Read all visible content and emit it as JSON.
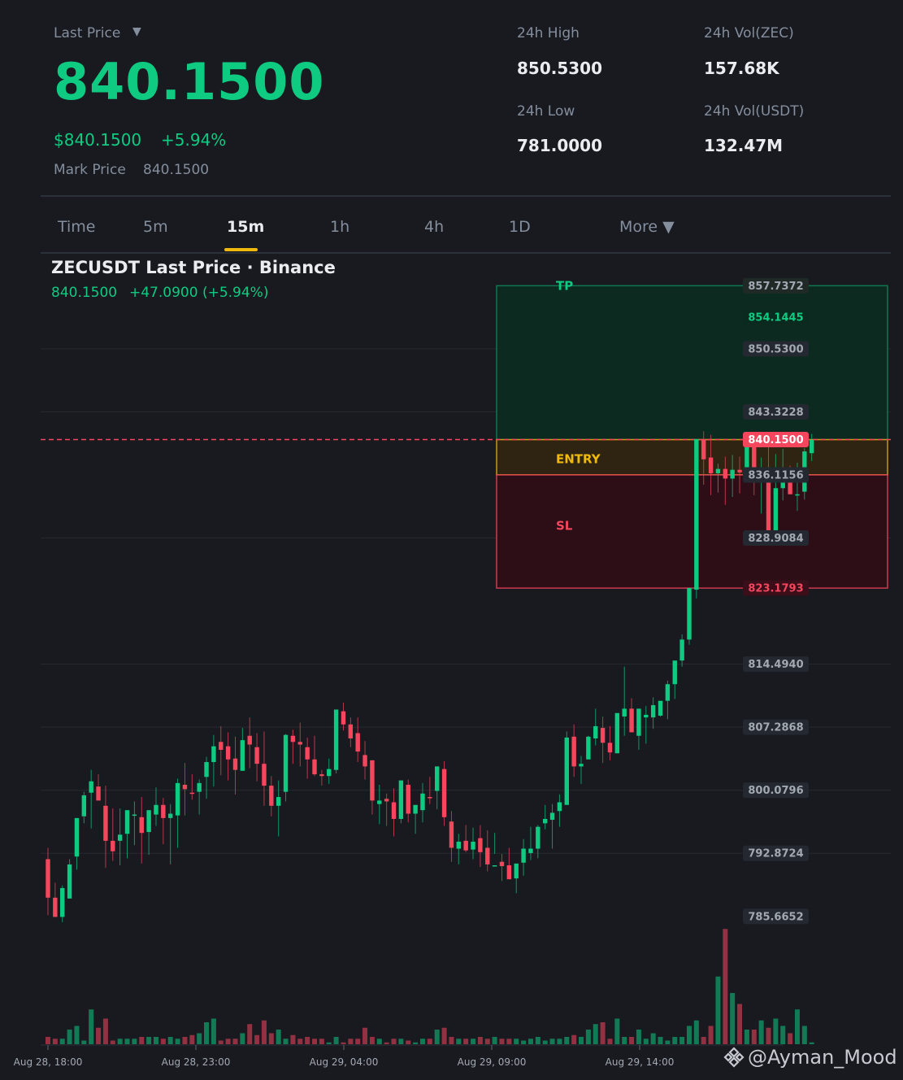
{
  "header": {
    "last_price_label": "Last Price",
    "last_price_caret": "▼",
    "last_price": "840.1500",
    "usd_price": "$840.1500",
    "change_pct": "+5.94%",
    "mark_price_label": "Mark Price",
    "mark_price": "840.1500"
  },
  "stats": {
    "high_label": "24h High",
    "high": "850.5300",
    "low_label": "24h Low",
    "low": "781.0000",
    "vol_base_label": "24h Vol(ZEC)",
    "vol_base": "157.68K",
    "vol_quote_label": "24h Vol(USDT)",
    "vol_quote": "132.47M"
  },
  "tabs": {
    "time": "Time",
    "m5": "5m",
    "m15": "15m",
    "h1": "1h",
    "h4": "4h",
    "d1": "1D",
    "more": "More ▼",
    "active": "15m"
  },
  "chart_header": {
    "title": "ZECUSDT Last Price · Binance",
    "price": "840.1500",
    "change": "+47.0900 (+5.94%)"
  },
  "position": {
    "tp_label": "TP",
    "entry_label": "ENTRY",
    "sl_label": "SL",
    "tp_price": 857.7372,
    "entry_price": 840.15,
    "sl_price": 823.1793
  },
  "watermark": "@Ayman_Mood",
  "colors": {
    "up": "#0ecb81",
    "down": "#f6465d",
    "accent": "#f0b90b",
    "bg": "#181a20"
  },
  "chart_data": {
    "type": "candlestick",
    "symbol": "ZECUSDT",
    "interval": "15m",
    "y_axis_ticks": [
      "857.7372",
      "854.1445",
      "850.5300",
      "843.3228",
      "840.1500",
      "836.1156",
      "828.9084",
      "823.1793",
      "814.4940",
      "807.2868",
      "800.0796",
      "792.8724",
      "785.6652"
    ],
    "x_axis_ticks": [
      "Aug 28, 18:00",
      "Aug 28, 23:00",
      "Aug 29, 04:00",
      "Aug 29, 09:00",
      "Aug 29, 14:00"
    ],
    "ylim": [
      784.9,
      861.3
    ],
    "last_price": 840.15,
    "candles": [
      [
        792.2,
        793.5,
        785.8,
        787.8,
        4
      ],
      [
        787.8,
        789.5,
        785.6,
        785.6,
        3
      ],
      [
        785.6,
        789.2,
        785,
        788.9,
        3
      ],
      [
        787.7,
        792.2,
        788.3,
        791.6,
        8
      ],
      [
        792.5,
        796.9,
        791.0,
        796.9,
        10
      ],
      [
        797.1,
        799.9,
        796.3,
        799.5,
        2
      ],
      [
        799.8,
        802.4,
        795.7,
        801.1,
        19
      ],
      [
        800.5,
        801.9,
        799,
        798.9,
        9
      ],
      [
        798.3,
        800.6,
        791.2,
        794.3,
        14
      ],
      [
        794.3,
        798,
        792,
        793.1,
        2
      ],
      [
        794.3,
        798,
        791.5,
        795,
        3
      ],
      [
        795.1,
        797.8,
        792.3,
        797.8,
        3
      ],
      [
        797.2,
        798.8,
        793.8,
        797.3,
        3
      ],
      [
        797,
        799.3,
        791.7,
        795.2,
        4
      ],
      [
        795.3,
        797.5,
        792.7,
        797.8,
        4
      ],
      [
        797.3,
        800.4,
        796,
        798.4,
        4
      ],
      [
        798.4,
        799.2,
        793.9,
        796.9,
        3
      ],
      [
        796.9,
        798.5,
        791.6,
        797.4,
        4
      ],
      [
        797.2,
        801.4,
        793.5,
        800.9,
        3
      ],
      [
        800.7,
        803.2,
        797.2,
        800.2,
        4
      ],
      [
        799.8,
        801.9,
        799,
        799.7,
        5
      ],
      [
        799.9,
        801.3,
        797.3,
        800.9,
        6
      ],
      [
        801.6,
        803.9,
        799.1,
        803.3,
        12
      ],
      [
        803.3,
        806.4,
        800.5,
        805.1,
        14
      ],
      [
        805.6,
        807.4,
        801.8,
        804.7,
        2
      ],
      [
        805.1,
        806.7,
        801.2,
        803.6,
        3
      ],
      [
        803.7,
        806.2,
        799.6,
        802.4,
        3
      ],
      [
        802.3,
        807.2,
        803.1,
        805.8,
        6
      ],
      [
        806.3,
        808.4,
        802.6,
        805.3,
        11
      ],
      [
        805,
        806.6,
        801.1,
        803.1,
        5
      ],
      [
        803.1,
        806.8,
        798.3,
        800.6,
        13
      ],
      [
        800.6,
        801.7,
        797.1,
        798.3,
        6
      ],
      [
        798.3,
        801.2,
        794.8,
        799.3,
        8
      ],
      [
        799.9,
        806.5,
        798.8,
        806.4,
        3
      ],
      [
        806.3,
        807,
        803.1,
        805.6,
        5
      ],
      [
        805.6,
        807.8,
        802.8,
        805.3,
        3
      ],
      [
        805,
        806.1,
        801.4,
        803.6,
        4
      ],
      [
        803.6,
        806.3,
        801.7,
        801.9,
        3
      ],
      [
        801.9,
        802.4,
        800.6,
        801.7,
        3
      ],
      [
        801.7,
        803.7,
        800.8,
        802.5,
        1
      ],
      [
        802.4,
        807.4,
        802,
        809.3,
        4
      ],
      [
        809.1,
        810.1,
        806.9,
        807.6,
        1
      ],
      [
        807.6,
        808.4,
        805,
        806,
        3
      ],
      [
        806.6,
        808.4,
        803.3,
        804.5,
        3
      ],
      [
        804.1,
        805.7,
        801.3,
        802.8,
        9
      ],
      [
        803.5,
        803.5,
        797.3,
        798.9,
        4
      ],
      [
        798.5,
        800.7,
        796.2,
        798.9,
        3
      ],
      [
        799.1,
        799.7,
        796,
        798.8,
        1
      ],
      [
        798.7,
        800.3,
        794.8,
        796.8,
        3
      ],
      [
        796.8,
        801,
        796.3,
        801.2,
        3
      ],
      [
        800.7,
        801.3,
        796.4,
        797.4,
        2
      ],
      [
        797.4,
        798.1,
        795.1,
        798.4,
        1
      ],
      [
        797.8,
        800.9,
        796.4,
        799.7,
        3
      ],
      [
        799.3,
        801.6,
        798.5,
        799.2,
        3
      ],
      [
        800,
        800.9,
        797.9,
        802.8,
        8
      ],
      [
        802.5,
        803.4,
        796,
        797,
        9
      ],
      [
        796.5,
        797.7,
        791.9,
        793.5,
        4
      ],
      [
        793.4,
        795.1,
        791.6,
        794.2,
        3
      ],
      [
        794.3,
        796.1,
        793,
        793.2,
        3
      ],
      [
        793.3,
        795.8,
        792.2,
        794.2,
        3
      ],
      [
        794.6,
        796.1,
        791.3,
        793,
        4
      ],
      [
        793.5,
        795.5,
        790.8,
        791.6,
        3
      ],
      [
        791.4,
        795.2,
        792.8,
        791.5,
        4
      ],
      [
        791.9,
        792.8,
        789.7,
        791.4,
        3
      ],
      [
        791.5,
        793.5,
        790,
        789.9,
        3
      ],
      [
        790,
        791,
        788.3,
        791.7,
        3
      ],
      [
        791.8,
        794.5,
        790.3,
        793.4,
        2
      ],
      [
        792.9,
        795.9,
        792.1,
        793.4,
        3
      ],
      [
        793.4,
        796.1,
        792.3,
        795.9,
        4
      ],
      [
        796.3,
        798.4,
        795.6,
        796.8,
        2
      ],
      [
        796.7,
        798.5,
        793.4,
        797.5,
        3
      ],
      [
        797.7,
        799.6,
        795.9,
        798.7,
        3
      ],
      [
        798.4,
        806.8,
        798.5,
        806.1,
        4
      ],
      [
        806.2,
        807.6,
        801.6,
        802.8,
        5
      ],
      [
        802.8,
        804,
        800.8,
        803.1,
        4
      ],
      [
        803.6,
        806.3,
        803.7,
        806.2,
        8
      ],
      [
        806,
        809.4,
        805.2,
        807.4,
        11
      ],
      [
        807.2,
        808.5,
        803.2,
        805.5,
        12
      ],
      [
        805.5,
        807.4,
        803.5,
        804.4,
        3
      ],
      [
        804.3,
        808.7,
        805.3,
        808.9,
        14
      ],
      [
        808.5,
        814.2,
        806.3,
        809.4,
        4
      ],
      [
        809.4,
        810.6,
        807.1,
        806.7,
        4
      ],
      [
        806.3,
        809,
        804.7,
        809.4,
        8
      ],
      [
        808.4,
        809.7,
        805.4,
        808.7,
        3
      ],
      [
        808.4,
        810.7,
        807.1,
        809.8,
        6
      ],
      [
        808.6,
        810,
        808.5,
        810.3,
        4
      ],
      [
        810.3,
        812.6,
        808.2,
        812.2,
        2
      ],
      [
        812.2,
        814.2,
        810.5,
        814.9,
        4
      ],
      [
        814.9,
        817.9,
        814.2,
        817.3,
        4
      ],
      [
        817.3,
        823.2,
        816.7,
        823.2,
        10
      ],
      [
        823,
        826.3,
        822,
        840.2,
        13
      ],
      [
        840.2,
        841.1,
        835,
        837.9,
        4
      ],
      [
        838.1,
        840.7,
        833.8,
        836.3,
        10
      ],
      [
        836.3,
        837.4,
        834.1,
        836.8,
        37
      ],
      [
        836.8,
        838.2,
        832.7,
        835.7,
        63
      ],
      [
        835.7,
        838.4,
        833.6,
        836.7,
        28
      ],
      [
        836.7,
        838.2,
        834,
        836.4,
        22
      ],
      [
        836.4,
        840.6,
        835.3,
        839.9,
        8
      ],
      [
        839.9,
        840.3,
        833.8,
        835.7,
        8
      ],
      [
        835.7,
        838.1,
        831.7,
        836.7,
        13
      ],
      [
        836.7,
        840.4,
        832.8,
        829.5,
        9
      ],
      [
        829.6,
        838.5,
        828.1,
        834.6,
        14
      ],
      [
        834.6,
        839.1,
        833.2,
        836.1,
        10
      ],
      [
        836.1,
        837.2,
        834.5,
        833.9,
        6
      ],
      [
        833.8,
        837.5,
        832,
        833.9,
        19
      ],
      [
        834.2,
        839.2,
        833.3,
        838.8,
        10
      ],
      [
        838.6,
        840.8,
        837.7,
        840.1,
        1
      ]
    ]
  }
}
